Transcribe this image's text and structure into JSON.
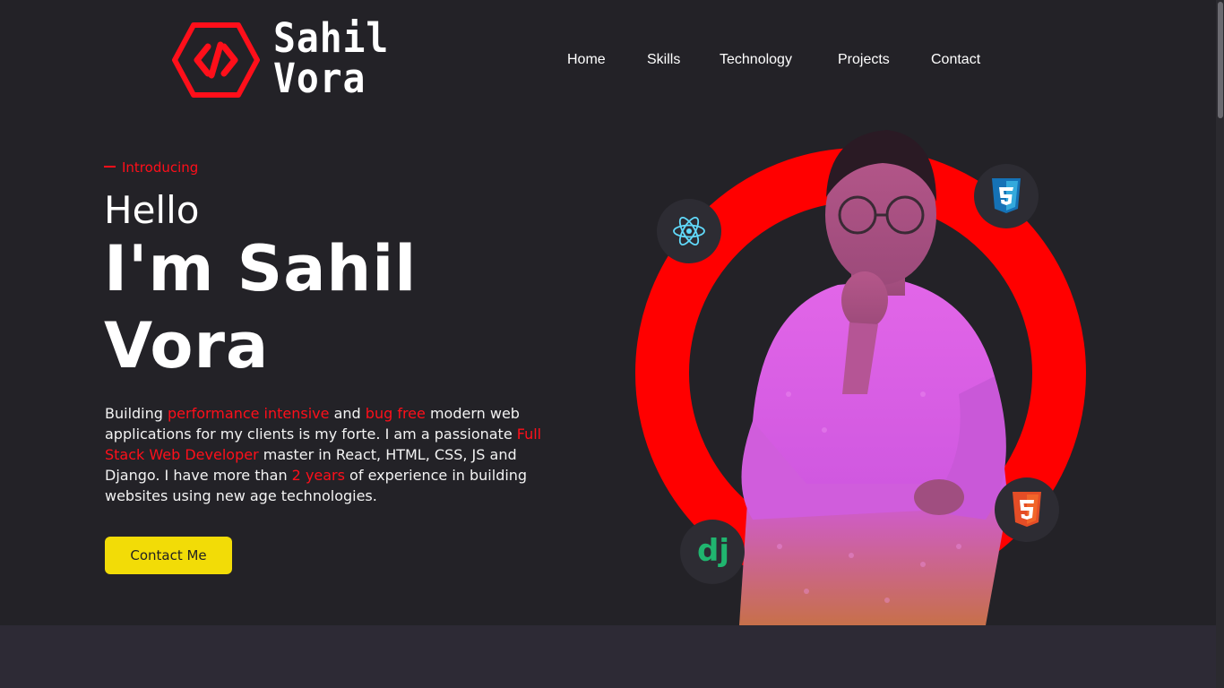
{
  "logo": {
    "first": "Sahil",
    "last": "Vora",
    "icon": "hexagon-code-icon"
  },
  "nav": {
    "items": [
      "Home",
      "Skills",
      "Technology",
      "Projects",
      "Contact"
    ]
  },
  "hero": {
    "intro": "Introducing",
    "hello": "Hello",
    "name_line1": "I'm Sahil",
    "name_line2": "Vora",
    "desc": [
      {
        "t": "Building ",
        "hl": false
      },
      {
        "t": "performance intensive",
        "hl": true
      },
      {
        "t": " and ",
        "hl": false
      },
      {
        "t": "bug free",
        "hl": true
      },
      {
        "t": " modern web applications for my clients is my forte. I am a passionate ",
        "hl": false
      },
      {
        "t": "Full Stack Web Developer",
        "hl": true
      },
      {
        "t": " master in React, HTML, CSS, JS and Django. I have more than ",
        "hl": false
      },
      {
        "t": "2 years",
        "hl": true
      },
      {
        "t": " of experience in building websites using new age technologies.",
        "hl": false
      }
    ],
    "cta_label": "Contact Me"
  },
  "tech_icons": [
    "react-icon",
    "css3-icon",
    "html5-icon",
    "django-icon"
  ],
  "colors": {
    "background": "#232227",
    "accent": "#ff0f1a",
    "ring": "#ff0000",
    "button": "#f2dc07",
    "band": "#2d2a35"
  }
}
